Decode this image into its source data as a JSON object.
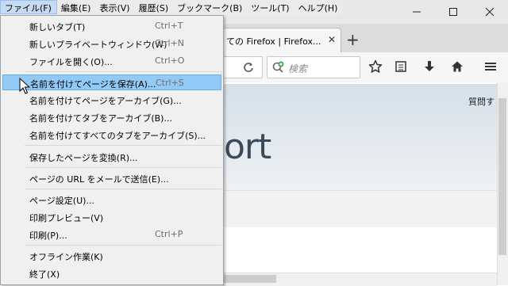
{
  "menubar": {
    "items": [
      "ファイル(F)",
      "編集(E)",
      "表示(V)",
      "履歴(S)",
      "ブックマーク(B)",
      "ツール(T)",
      "ヘルプ(H)"
    ]
  },
  "tab": {
    "title": "ての Firefox | Firefox..."
  },
  "search": {
    "placeholder": "検索"
  },
  "page": {
    "hero_text": "ort",
    "ask_text": "質問す"
  },
  "file_menu": {
    "items": [
      {
        "label": "新しいタブ(T)",
        "shortcut": "Ctrl+T"
      },
      {
        "label": "新しいプライベートウィンドウ(W)",
        "shortcut": "Ctrl+N"
      },
      {
        "label": "ファイルを開く(O)...",
        "shortcut": "Ctrl+O"
      },
      {
        "label": "名前を付けてページを保存(A)...",
        "shortcut": "Ctrl+S"
      },
      {
        "label": "名前を付けてページをアーカイブ(G)...",
        "shortcut": ""
      },
      {
        "label": "名前を付けてタブをアーカイブ(B)...",
        "shortcut": ""
      },
      {
        "label": "名前を付けてすべてのタブをアーカイブ(S)...",
        "shortcut": ""
      },
      {
        "label": "保存したページを変換(R)...",
        "shortcut": ""
      },
      {
        "label": "ページの URL をメールで送信(E)...",
        "shortcut": ""
      },
      {
        "label": "ページ設定(U)...",
        "shortcut": ""
      },
      {
        "label": "印刷プレビュー(V)",
        "shortcut": ""
      },
      {
        "label": "印刷(P)...",
        "shortcut": "Ctrl+P"
      },
      {
        "label": "オフライン作業(K)",
        "shortcut": ""
      },
      {
        "label": "終了(X)",
        "shortcut": ""
      }
    ]
  },
  "colors": {
    "highlight": "#91c9f7",
    "menu_bg": "#f0f0f0",
    "menubar_active": "#c6daf3"
  },
  "icons": [
    "minimize-icon",
    "maximize-icon",
    "close-icon",
    "reload-icon",
    "search-add-icon",
    "bookmark-star-icon",
    "reading-list-icon",
    "download-icon",
    "home-icon",
    "hamburger-menu-icon"
  ]
}
